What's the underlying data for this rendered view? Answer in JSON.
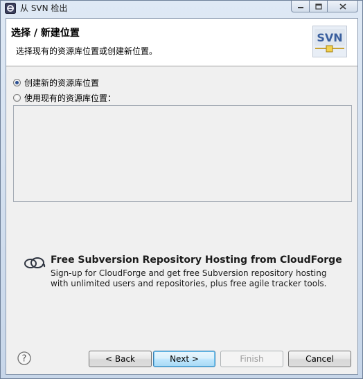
{
  "window": {
    "title": "从 SVN 检出"
  },
  "banner": {
    "title": "选择 / 新建位置",
    "description": "选择现有的资源库位置或创建新位置。",
    "logo_text": "SVN"
  },
  "options": {
    "create_new_label": "创建新的资源库位置",
    "use_existing_label": "使用现有的资源库位置：",
    "selected": "create_new"
  },
  "promo": {
    "title": "Free Subversion Repository Hosting from CloudForge",
    "line1": "Sign-up for CloudForge and get free Subversion repository hosting",
    "line2": "with unlimited users and repositories, plus free agile tracker tools."
  },
  "footer": {
    "back_label": "< Back",
    "next_label": "Next >",
    "finish_label": "Finish",
    "cancel_label": "Cancel"
  },
  "icons": {
    "app": "eclipse-app-icon",
    "minimize": "minimize-icon",
    "maximize": "maximize-icon",
    "close": "close-icon",
    "banner": "svn-logo-icon",
    "promo": "cloudforge-icon",
    "help": "help-icon"
  }
}
